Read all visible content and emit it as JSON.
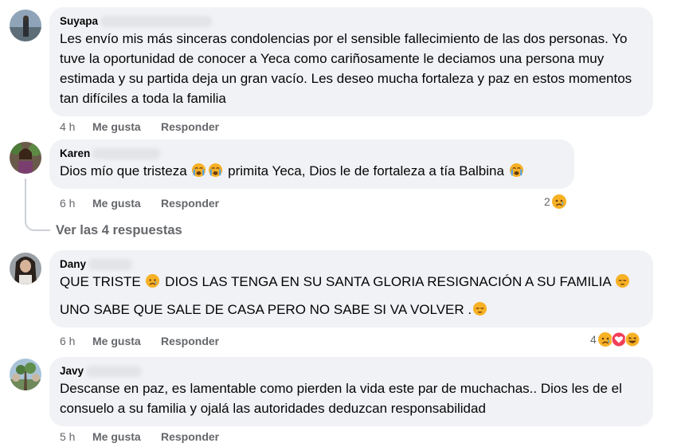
{
  "comments": [
    {
      "author": "Suyapa",
      "paragraphs": [
        "Les envío mis más sinceras condolencias por el sensible fallecimiento de las dos personas. Yo tuve la oportunidad de conocer a Yeca como cariñosamente le deciamos una persona muy estimada y su partida deja un gran vacío. Les deseo mucha fortaleza y paz en estos momentos tan difíciles a toda la familia"
      ],
      "time": "4 h",
      "like_label": "Me gusta",
      "reply_label": "Responder"
    },
    {
      "author": "Karen",
      "text_parts": [
        "Dios mío que tristeza ",
        " primita Yeca, Dios le de fortaleza a tía Balbina "
      ],
      "time": "6 h",
      "like_label": "Me gusta",
      "reply_label": "Responder",
      "reaction_count": "2",
      "reaction_icons": [
        "sad-reaction-icon"
      ],
      "view_replies": "Ver las 4 respuestas"
    },
    {
      "author": "Dany",
      "line1_parts": [
        "QUE TRISTE ",
        " DIOS LAS TENGA EN SU SANTA GLORIA RESIGNACIÓN A SU FAMILIA "
      ],
      "line2": "UNO SABE QUE SALE DE CASA PERO NO SABE SI VA VOLVER .",
      "time": "6 h",
      "like_label": "Me gusta",
      "reply_label": "Responder",
      "reaction_count": "4",
      "reaction_icons": [
        "sad-reaction-icon",
        "love-reaction-icon",
        "haha-reaction-icon"
      ]
    },
    {
      "author": "Javy",
      "paragraphs": [
        "Descanse en paz, es lamentable como pierden la vida este par de muchachas.. Dios les de el consuelo a su familia y ojalá las autoridades deduzcan responsabilidad"
      ],
      "time": "5 h",
      "like_label": "Me gusta",
      "reply_label": "Responder"
    }
  ],
  "colors": {
    "bubble_bg": "#f0f2f5",
    "meta_text": "#65676b",
    "primary_text": "#050505",
    "like_blue": "#1877f2",
    "love_red": "#f33e58",
    "emoji_yellow": "#f7b125"
  }
}
